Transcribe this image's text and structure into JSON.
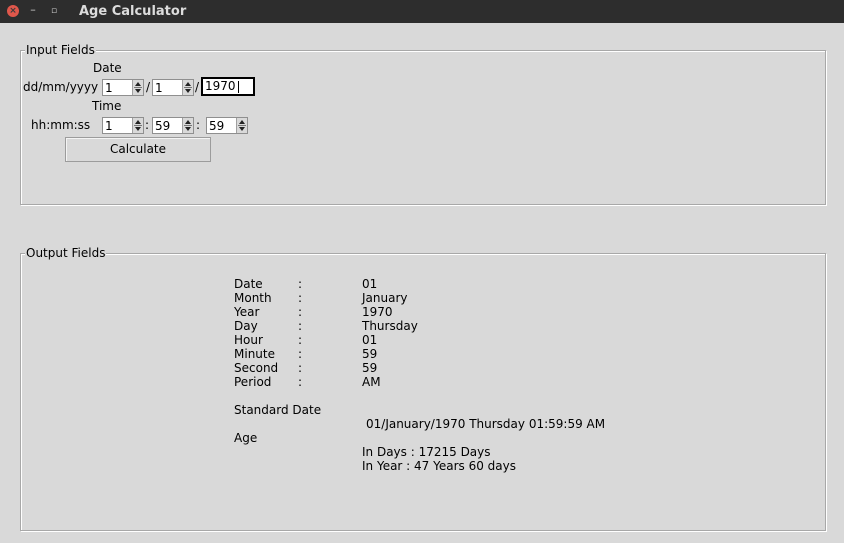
{
  "window": {
    "title": "Age Calculator",
    "close_glyph": "×",
    "min_glyph": "–",
    "max_glyph": "▫"
  },
  "input_group": {
    "legend": "Input Fields",
    "date_heading": "Date",
    "date_format_label": "dd/mm/yyyy",
    "day_value": "1",
    "month_value": "1",
    "year_value": "1970",
    "date_separator": "/",
    "time_heading": "Time",
    "time_format_label": "hh:mm:ss",
    "hour_value": "1",
    "minute_value": "59",
    "second_value": "59",
    "time_separator": ":",
    "calculate_label": "Calculate"
  },
  "output_group": {
    "legend": "Output Fields",
    "colon": ":",
    "rows": [
      {
        "label": "Date",
        "value": "01"
      },
      {
        "label": "Month",
        "value": "January"
      },
      {
        "label": "Year",
        "value": "1970"
      },
      {
        "label": "Day",
        "value": "Thursday"
      },
      {
        "label": "Hour",
        "value": "01"
      },
      {
        "label": "Minute",
        "value": "59"
      },
      {
        "label": "Second",
        "value": "59"
      },
      {
        "label": "Period",
        "value": "AM"
      }
    ],
    "standard_date_label": "Standard Date",
    "standard_date_value": "01/January/1970 Thursday 01:59:59 AM",
    "age_label": "Age",
    "in_days": "In Days : 17215 Days",
    "in_years": "In Year : 47 Years 60 days"
  }
}
